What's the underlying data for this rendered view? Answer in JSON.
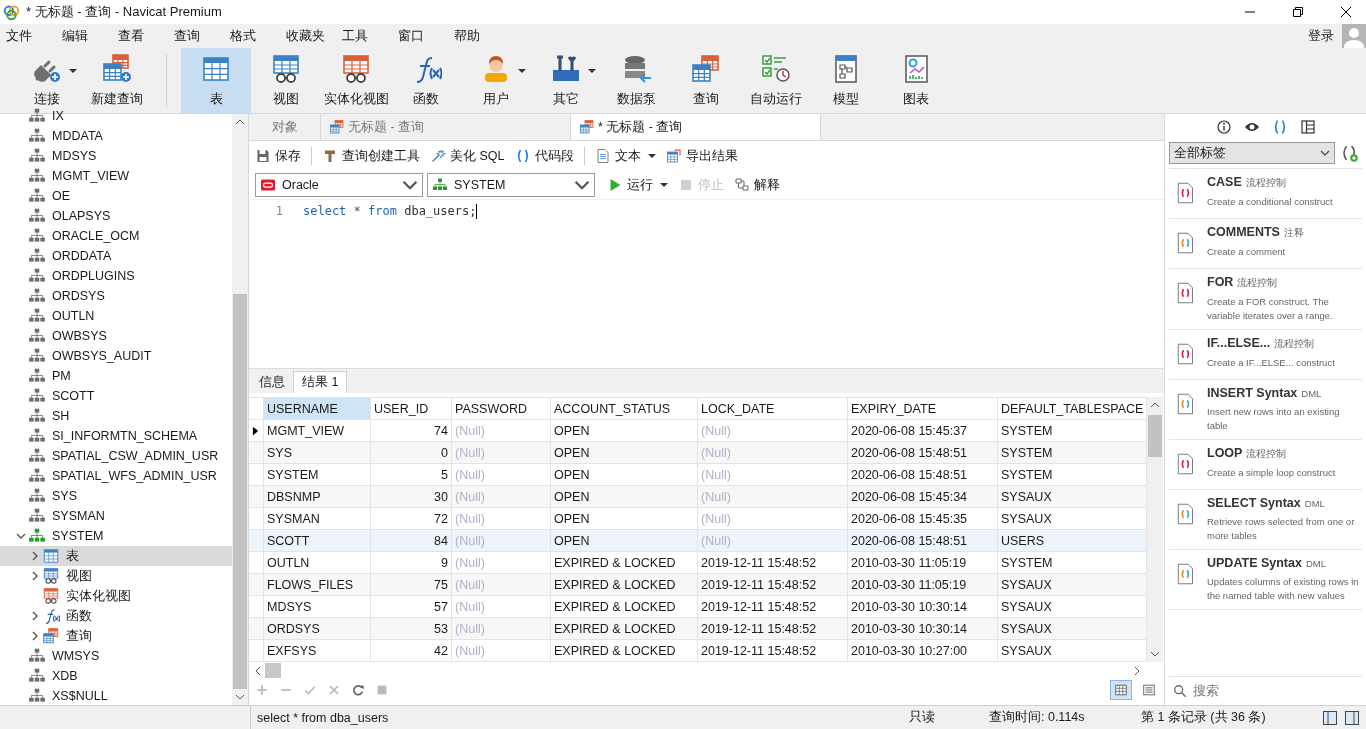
{
  "window": {
    "title": "* 无标题 - 查询 - Navicat Premium"
  },
  "menu": [
    "文件",
    "编辑",
    "查看",
    "查询",
    "格式",
    "收藏夹",
    "工具",
    "窗口",
    "帮助"
  ],
  "account": {
    "login": "登录"
  },
  "toolbar": [
    {
      "items": [
        {
          "label": "连接",
          "kind": "connect",
          "selected": false,
          "dropdown": true
        },
        {
          "label": "新建查询",
          "kind": "new_query",
          "selected": false
        }
      ]
    },
    {
      "items": [
        {
          "label": "表",
          "kind": "table",
          "selected": true
        },
        {
          "label": "视图",
          "kind": "view",
          "selected": false
        },
        {
          "label": "实体化视图",
          "kind": "matview",
          "selected": false
        },
        {
          "label": "函数",
          "kind": "function",
          "selected": false
        },
        {
          "label": "用户",
          "kind": "user",
          "selected": false,
          "dropdown": true
        },
        {
          "label": "其它",
          "kind": "other",
          "selected": false,
          "dropdown": true
        },
        {
          "label": "数据泵",
          "kind": "datapump",
          "selected": false
        },
        {
          "label": "查询",
          "kind": "query",
          "selected": false
        },
        {
          "label": "自动运行",
          "kind": "autorun",
          "selected": false
        },
        {
          "label": "模型",
          "kind": "model",
          "selected": false
        },
        {
          "label": "图表",
          "kind": "chart",
          "selected": false
        }
      ]
    }
  ],
  "sidebar": {
    "items": [
      {
        "label": "IX",
        "expanded": false
      },
      {
        "label": "MDDATA",
        "expanded": false
      },
      {
        "label": "MDSYS",
        "expanded": false
      },
      {
        "label": "MGMT_VIEW",
        "expanded": false
      },
      {
        "label": "OE",
        "expanded": false
      },
      {
        "label": "OLAPSYS",
        "expanded": false
      },
      {
        "label": "ORACLE_OCM",
        "expanded": false
      },
      {
        "label": "ORDDATA",
        "expanded": false
      },
      {
        "label": "ORDPLUGINS",
        "expanded": false
      },
      {
        "label": "ORDSYS",
        "expanded": false
      },
      {
        "label": "OUTLN",
        "expanded": false
      },
      {
        "label": "OWBSYS",
        "expanded": false
      },
      {
        "label": "OWBSYS_AUDIT",
        "expanded": false
      },
      {
        "label": "PM",
        "expanded": false
      },
      {
        "label": "SCOTT",
        "expanded": false
      },
      {
        "label": "SH",
        "expanded": false
      },
      {
        "label": "SI_INFORMTN_SCHEMA",
        "expanded": false
      },
      {
        "label": "SPATIAL_CSW_ADMIN_USR",
        "expanded": false
      },
      {
        "label": "SPATIAL_WFS_ADMIN_USR",
        "expanded": false
      },
      {
        "label": "SYS",
        "expanded": false
      },
      {
        "label": "SYSMAN",
        "expanded": false
      },
      {
        "label": "SYSTEM",
        "expanded": true,
        "children": [
          {
            "label": "表",
            "kind": "table",
            "expandable": true,
            "selected": true
          },
          {
            "label": "视图",
            "kind": "view",
            "expandable": true,
            "selected": false
          },
          {
            "label": "实体化视图",
            "kind": "matview",
            "expandable": false,
            "selected": false
          },
          {
            "label": "函数",
            "kind": "function",
            "expandable": true,
            "selected": false
          },
          {
            "label": "查询",
            "kind": "query",
            "expandable": true,
            "selected": false
          }
        ]
      },
      {
        "label": "WMSYS",
        "expanded": false
      },
      {
        "label": "XDB",
        "expanded": false
      },
      {
        "label": "XS$NULL",
        "expanded": false
      }
    ]
  },
  "tabs": [
    {
      "label": "对象",
      "icon": false,
      "selected": false
    },
    {
      "label": "无标题 - 查询",
      "icon": true,
      "selected": false
    },
    {
      "label": "* 无标题 - 查询",
      "icon": true,
      "selected": true
    }
  ],
  "query_toolbar": [
    {
      "items": [
        {
          "label": "保存",
          "kind": "save"
        }
      ]
    },
    {
      "items": [
        {
          "label": "查询创建工具",
          "kind": "builder"
        },
        {
          "label": "美化 SQL",
          "kind": "beautify"
        },
        {
          "label": "代码段",
          "kind": "snippet"
        }
      ]
    },
    {
      "items": [
        {
          "label": "文本",
          "kind": "text",
          "dropdown": true
        },
        {
          "label": "导出结果",
          "kind": "export"
        }
      ]
    }
  ],
  "connection": {
    "value": "Oracle"
  },
  "schema": {
    "value": "SYSTEM"
  },
  "run_controls": [
    {
      "label": "运行",
      "kind": "run",
      "dropdown": true,
      "disabled": false
    },
    {
      "label": "停止",
      "kind": "stop",
      "disabled": true
    },
    {
      "label": "解释",
      "kind": "explain",
      "disabled": false
    }
  ],
  "editor": {
    "lines": [
      {
        "number": "1",
        "tokens": [
          {
            "text": "select",
            "kind": "keyword"
          },
          {
            "text": " * ",
            "kind": "operator"
          },
          {
            "text": "from",
            "kind": "keyword"
          },
          {
            "text": " dba_users;",
            "kind": "plain"
          }
        ]
      }
    ]
  },
  "result_tabs": [
    {
      "label": "信息",
      "selected": false
    },
    {
      "label": "结果 1",
      "selected": true
    }
  ],
  "table": {
    "columns": [
      {
        "name": "USERNAME",
        "numeric": false,
        "selected": true
      },
      {
        "name": "USER_ID",
        "numeric": true,
        "selected": false
      },
      {
        "name": "PASSWORD",
        "numeric": false,
        "selected": false
      },
      {
        "name": "ACCOUNT_STATUS",
        "numeric": false,
        "selected": false
      },
      {
        "name": "LOCK_DATE",
        "numeric": false,
        "selected": false
      },
      {
        "name": "EXPIRY_DATE",
        "numeric": false,
        "selected": false
      },
      {
        "name": "DEFAULT_TABLESPACE",
        "numeric": false,
        "selected": false
      }
    ],
    "rows": [
      {
        "current": true,
        "highlighted": false,
        "cells": [
          {
            "v": "MGMT_VIEW",
            "null": false
          },
          {
            "v": "74",
            "null": false
          },
          {
            "v": "(Null)",
            "null": true
          },
          {
            "v": "OPEN",
            "null": false
          },
          {
            "v": "(Null)",
            "null": true
          },
          {
            "v": "2020-06-08 15:45:37",
            "null": false
          },
          {
            "v": "SYSTEM",
            "null": false
          }
        ]
      },
      {
        "current": false,
        "highlighted": false,
        "cells": [
          {
            "v": "SYS",
            "null": false
          },
          {
            "v": "0",
            "null": false
          },
          {
            "v": "(Null)",
            "null": true
          },
          {
            "v": "OPEN",
            "null": false
          },
          {
            "v": "(Null)",
            "null": true
          },
          {
            "v": "2020-06-08 15:48:51",
            "null": false
          },
          {
            "v": "SYSTEM",
            "null": false
          }
        ]
      },
      {
        "current": false,
        "highlighted": false,
        "cells": [
          {
            "v": "SYSTEM",
            "null": false
          },
          {
            "v": "5",
            "null": false
          },
          {
            "v": "(Null)",
            "null": true
          },
          {
            "v": "OPEN",
            "null": false
          },
          {
            "v": "(Null)",
            "null": true
          },
          {
            "v": "2020-06-08 15:48:51",
            "null": false
          },
          {
            "v": "SYSTEM",
            "null": false
          }
        ]
      },
      {
        "current": false,
        "highlighted": false,
        "cells": [
          {
            "v": "DBSNMP",
            "null": false
          },
          {
            "v": "30",
            "null": false
          },
          {
            "v": "(Null)",
            "null": true
          },
          {
            "v": "OPEN",
            "null": false
          },
          {
            "v": "(Null)",
            "null": true
          },
          {
            "v": "2020-06-08 15:45:34",
            "null": false
          },
          {
            "v": "SYSAUX",
            "null": false
          }
        ]
      },
      {
        "current": false,
        "highlighted": false,
        "cells": [
          {
            "v": "SYSMAN",
            "null": false
          },
          {
            "v": "72",
            "null": false
          },
          {
            "v": "(Null)",
            "null": true
          },
          {
            "v": "OPEN",
            "null": false
          },
          {
            "v": "(Null)",
            "null": true
          },
          {
            "v": "2020-06-08 15:45:35",
            "null": false
          },
          {
            "v": "SYSAUX",
            "null": false
          }
        ]
      },
      {
        "current": false,
        "highlighted": true,
        "cells": [
          {
            "v": "SCOTT",
            "null": false
          },
          {
            "v": "84",
            "null": false
          },
          {
            "v": "(Null)",
            "null": true
          },
          {
            "v": "OPEN",
            "null": false
          },
          {
            "v": "(Null)",
            "null": true
          },
          {
            "v": "2020-06-08 15:48:51",
            "null": false
          },
          {
            "v": "USERS",
            "null": false
          }
        ]
      },
      {
        "current": false,
        "highlighted": false,
        "cells": [
          {
            "v": "OUTLN",
            "null": false
          },
          {
            "v": "9",
            "null": false
          },
          {
            "v": "(Null)",
            "null": true
          },
          {
            "v": "EXPIRED & LOCKED",
            "null": false
          },
          {
            "v": "2019-12-11 15:48:52",
            "null": false
          },
          {
            "v": "2010-03-30 11:05:19",
            "null": false
          },
          {
            "v": "SYSTEM",
            "null": false
          }
        ]
      },
      {
        "current": false,
        "highlighted": false,
        "cells": [
          {
            "v": "FLOWS_FILES",
            "null": false
          },
          {
            "v": "75",
            "null": false
          },
          {
            "v": "(Null)",
            "null": true
          },
          {
            "v": "EXPIRED & LOCKED",
            "null": false
          },
          {
            "v": "2019-12-11 15:48:52",
            "null": false
          },
          {
            "v": "2010-03-30 11:05:19",
            "null": false
          },
          {
            "v": "SYSAUX",
            "null": false
          }
        ]
      },
      {
        "current": false,
        "highlighted": false,
        "cells": [
          {
            "v": "MDSYS",
            "null": false
          },
          {
            "v": "57",
            "null": false
          },
          {
            "v": "(Null)",
            "null": true
          },
          {
            "v": "EXPIRED & LOCKED",
            "null": false
          },
          {
            "v": "2019-12-11 15:48:52",
            "null": false
          },
          {
            "v": "2010-03-30 10:30:14",
            "null": false
          },
          {
            "v": "SYSAUX",
            "null": false
          }
        ]
      },
      {
        "current": false,
        "highlighted": false,
        "cells": [
          {
            "v": "ORDSYS",
            "null": false
          },
          {
            "v": "53",
            "null": false
          },
          {
            "v": "(Null)",
            "null": true
          },
          {
            "v": "EXPIRED & LOCKED",
            "null": false
          },
          {
            "v": "2019-12-11 15:48:52",
            "null": false
          },
          {
            "v": "2010-03-30 10:30:14",
            "null": false
          },
          {
            "v": "SYSAUX",
            "null": false
          }
        ]
      },
      {
        "current": false,
        "highlighted": false,
        "cells": [
          {
            "v": "EXFSYS",
            "null": false
          },
          {
            "v": "42",
            "null": false
          },
          {
            "v": "(Null)",
            "null": true
          },
          {
            "v": "EXPIRED & LOCKED",
            "null": false
          },
          {
            "v": "2019-12-11 15:48:52",
            "null": false
          },
          {
            "v": "2010-03-30 10:27:00",
            "null": false
          },
          {
            "v": "SYSAUX",
            "null": false
          }
        ]
      }
    ]
  },
  "grid_tools": [
    {
      "kind": "add"
    },
    {
      "kind": "remove"
    },
    {
      "kind": "apply"
    },
    {
      "kind": "cancel"
    },
    {
      "kind": "refresh"
    },
    {
      "kind": "stop"
    }
  ],
  "view_modes": [
    {
      "kind": "grid",
      "selected": true
    },
    {
      "kind": "form",
      "selected": false
    }
  ],
  "right_panel": {
    "tabs": [
      {
        "kind": "info",
        "selected": false
      },
      {
        "kind": "preview",
        "selected": false
      },
      {
        "kind": "snippets",
        "selected": true
      },
      {
        "kind": "layout",
        "selected": false
      }
    ],
    "filter": {
      "value": "全部标签"
    },
    "snippets": [
      {
        "title": "CASE",
        "tag": "流程控制",
        "description": "Create a conditional construct",
        "kind": "flow"
      },
      {
        "title": "COMMENTS",
        "tag": "注释",
        "description": "Create a comment",
        "kind": "dml"
      },
      {
        "title": "FOR",
        "tag": "流程控制",
        "description": "Create a FOR construct. The variable iterates over a range.",
        "kind": "flow"
      },
      {
        "title": "IF...ELSE...",
        "tag": "流程控制",
        "description": "Create a IF...ELSE... construct",
        "kind": "flow"
      },
      {
        "title": "INSERT Syntax",
        "tag": "DML",
        "description": "Insert new rows into an existing table",
        "kind": "dml"
      },
      {
        "title": "LOOP",
        "tag": "流程控制",
        "description": "Create a simple loop construct",
        "kind": "flow"
      },
      {
        "title": "SELECT Syntax",
        "tag": "DML",
        "description": "Retrieve rows selected from one or more tables",
        "kind": "dml"
      },
      {
        "title": "UPDATE Syntax",
        "tag": "DML",
        "description": "Updates columns of existing rows in the named table with new values",
        "kind": "dml"
      }
    ],
    "search": {
      "placeholder": "搜索"
    }
  },
  "status_bar": {
    "query": "select * from dba_users",
    "mode": "只读",
    "time": "查询时间: 0.114s",
    "record": "第 1 条记录 (共 36 条)"
  }
}
